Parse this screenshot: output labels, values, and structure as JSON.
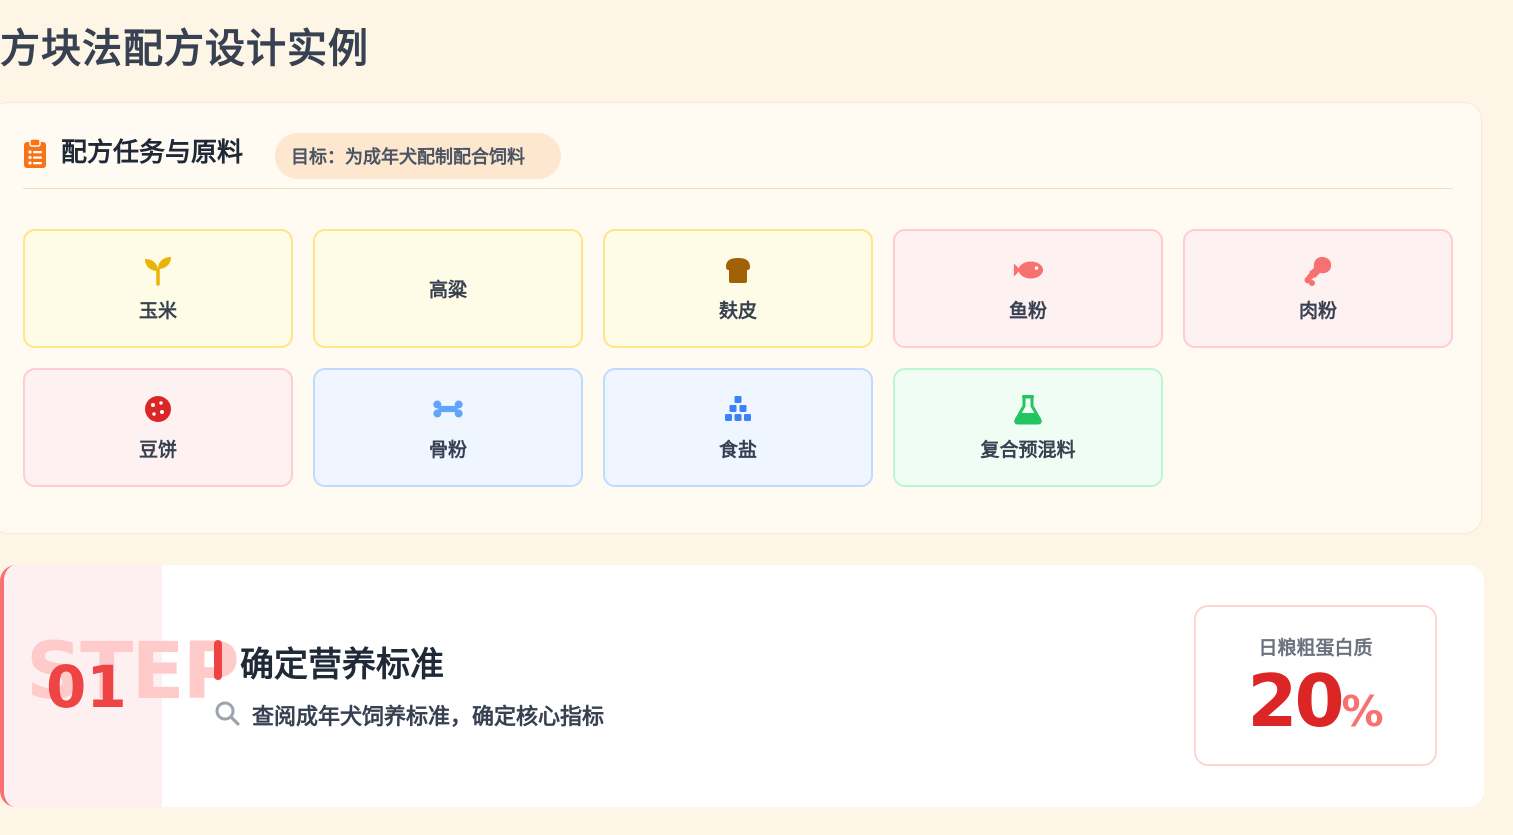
{
  "page": {
    "title": "方块法配方设计实例"
  },
  "task": {
    "title": "配方任务与原料",
    "goal": "目标：为成年犬配制配合饲料",
    "icon": "clipboard-list-icon",
    "ingredients": [
      {
        "label": "玉米",
        "icon": "seedling-icon",
        "color": "#eab308",
        "theme": "yellow"
      },
      {
        "label": "高粱",
        "icon": "",
        "color": "",
        "theme": "yellow"
      },
      {
        "label": "麸皮",
        "icon": "bread-icon",
        "color": "#a16207",
        "theme": "yellow"
      },
      {
        "label": "鱼粉",
        "icon": "fish-icon",
        "color": "#f87171",
        "theme": "pink"
      },
      {
        "label": "肉粉",
        "icon": "drumstick-icon",
        "color": "#f87171",
        "theme": "pink"
      },
      {
        "label": "豆饼",
        "icon": "cookie-icon",
        "color": "#dc2626",
        "theme": "pink"
      },
      {
        "label": "骨粉",
        "icon": "bone-icon",
        "color": "#60a5fa",
        "theme": "blue"
      },
      {
        "label": "食盐",
        "icon": "cubes-icon",
        "color": "#3b82f6",
        "theme": "blue"
      },
      {
        "label": "复合预混料",
        "icon": "flask-icon",
        "color": "#22c55e",
        "theme": "green"
      }
    ]
  },
  "step": {
    "watermark": "STEP",
    "number": "01",
    "title": "确定营养标准",
    "description": "查阅成年犬饲养标准，确定核心指标",
    "description_icon": "search-icon",
    "metric": {
      "label": "日粮粗蛋白质",
      "value": "20",
      "unit": "%"
    }
  },
  "colors": {
    "background": "#fdf5e6",
    "accent": "#ef4444",
    "goal_pill": "#fde8cf"
  }
}
